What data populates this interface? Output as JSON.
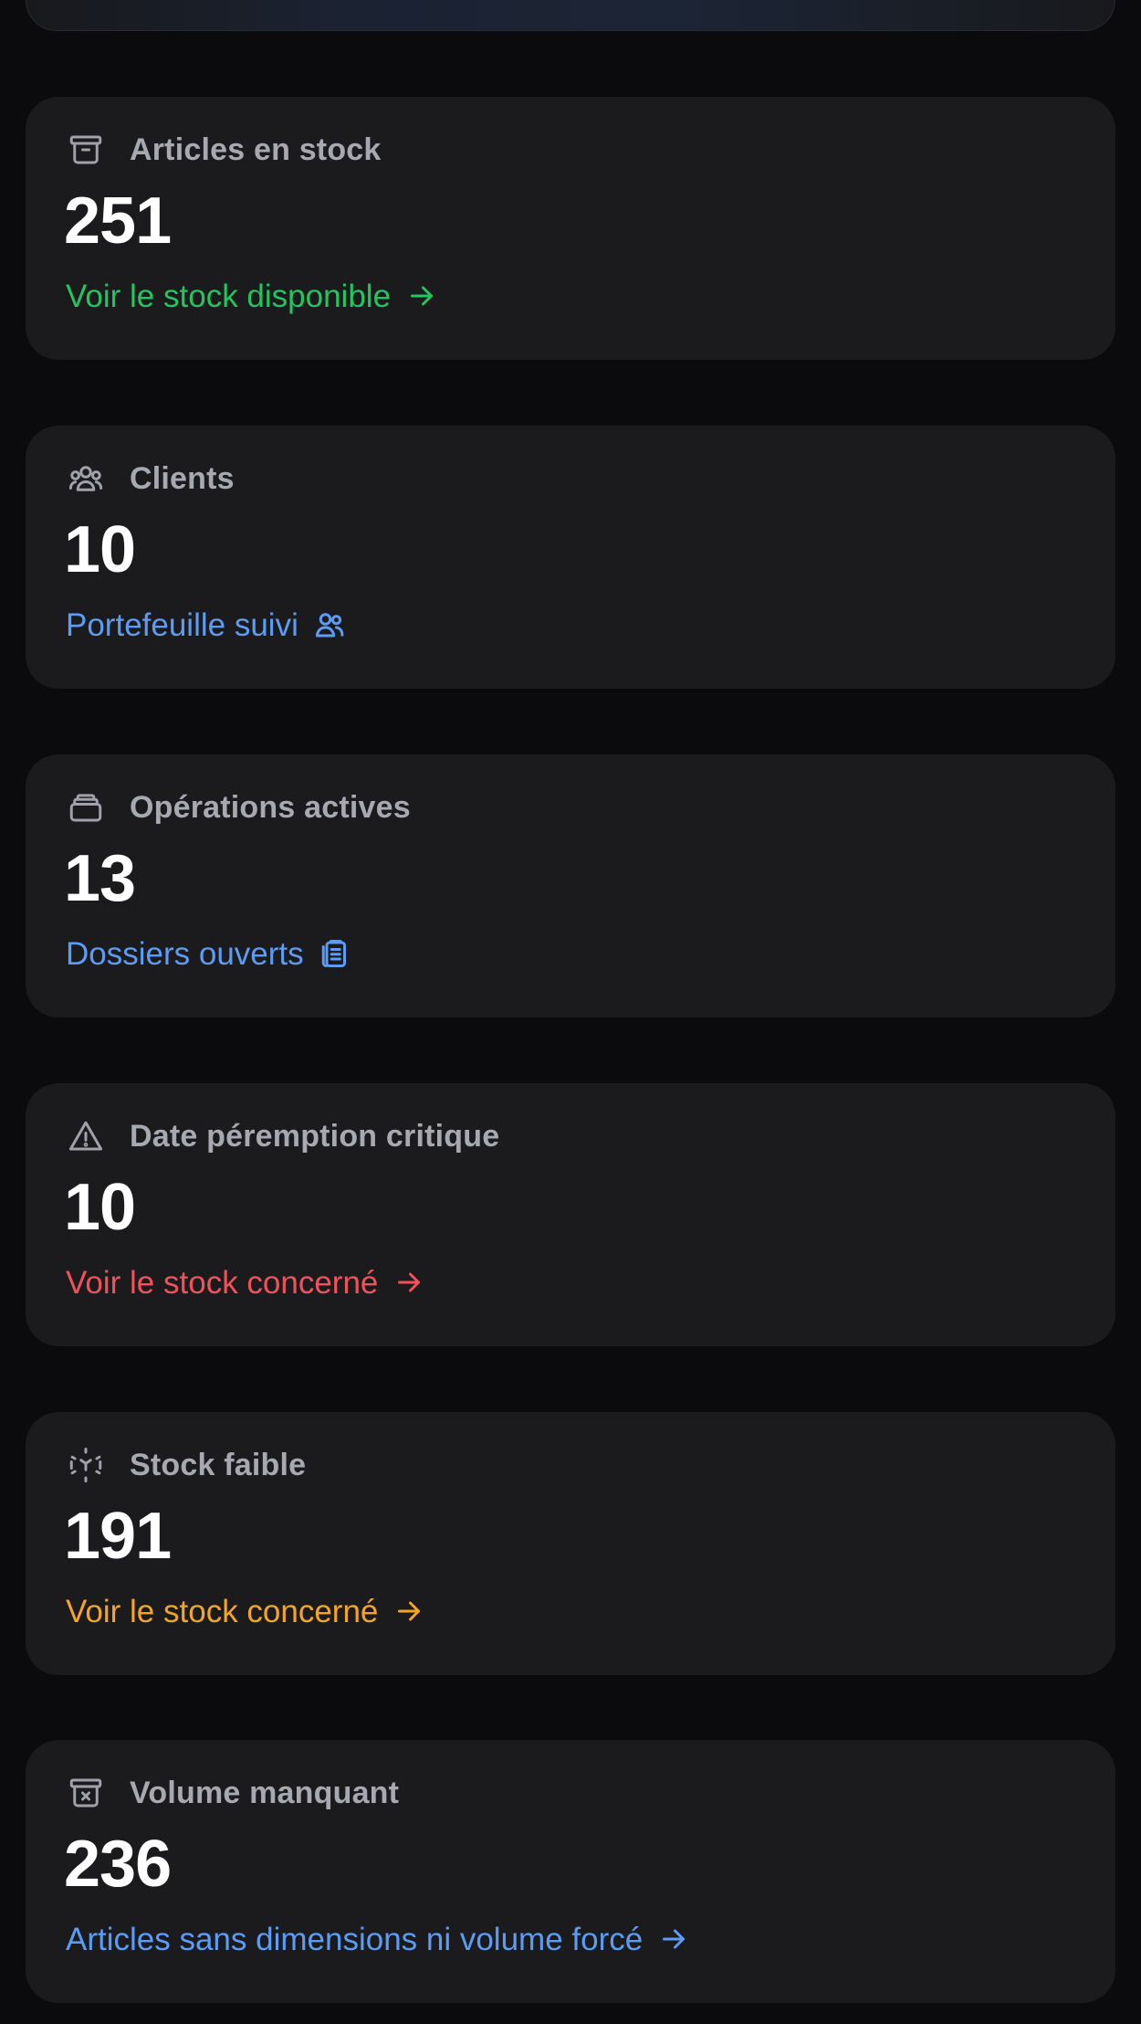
{
  "colors": {
    "green": "#22c55e",
    "blue": "#5b9cf5",
    "red": "#f0525a",
    "amber": "#f5a524"
  },
  "cards": [
    {
      "icon": "archive-icon",
      "label": "Articles en stock",
      "value": "251",
      "link_label": "Voir le stock disponible",
      "link_icon": "arrow-right-icon",
      "link_color": "green"
    },
    {
      "icon": "users-icon",
      "label": "Clients",
      "value": "10",
      "link_label": "Portefeuille suivi",
      "link_icon": "users-icon",
      "link_color": "blue"
    },
    {
      "icon": "layers-icon",
      "label": "Opérations actives",
      "value": "13",
      "link_label": "Dossiers ouverts",
      "link_icon": "clipboard-icon",
      "link_color": "blue"
    },
    {
      "icon": "alert-triangle-icon",
      "label": "Date péremption critique",
      "value": "10",
      "link_label": "Voir le stock concerné",
      "link_icon": "arrow-right-icon",
      "link_color": "red"
    },
    {
      "icon": "box-dashed-icon",
      "label": "Stock faible",
      "value": "191",
      "link_label": "Voir le stock concerné",
      "link_icon": "arrow-right-icon",
      "link_color": "amber"
    },
    {
      "icon": "archive-x-icon",
      "label": "Volume manquant",
      "value": "236",
      "link_label": "Articles sans dimensions ni volume forcé",
      "link_icon": "arrow-right-icon",
      "link_color": "blue"
    }
  ]
}
